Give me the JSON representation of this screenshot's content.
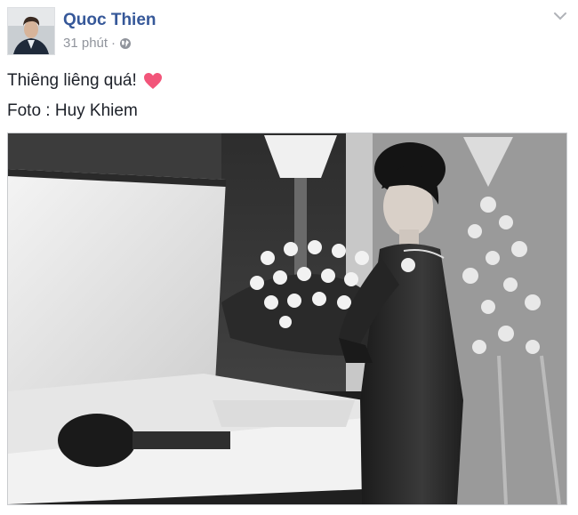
{
  "author": {
    "name": "Quoc Thien",
    "avatar_icon": "avatar-photo"
  },
  "meta": {
    "time": "31 phút",
    "separator": "·",
    "privacy_icon": "globe-icon"
  },
  "menu": {
    "icon": "chevron-down-icon"
  },
  "post": {
    "line1": "Thiêng liêng quá!",
    "emoji": "heart-icon",
    "line2": "Foto : Huy Khiem"
  },
  "photo": {
    "icon": "post-photo"
  },
  "colors": {
    "link": "#365899",
    "meta": "#90949c",
    "text": "#1d2129",
    "heart": "#f2557a"
  }
}
